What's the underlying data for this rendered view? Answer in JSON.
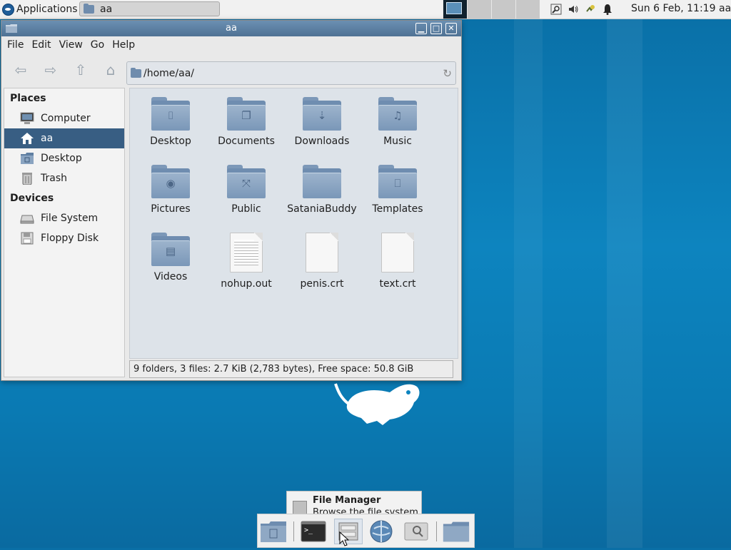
{
  "top_panel": {
    "applications_label": "Applications",
    "task_label": "aa",
    "clock": "Sun  6 Feb, 11:19",
    "user": "aa"
  },
  "window": {
    "title": "aa",
    "menu": [
      "File",
      "Edit",
      "View",
      "Go",
      "Help"
    ],
    "path": "/home/aa/",
    "sidebar": {
      "places_heading": "Places",
      "places": [
        "Computer",
        "aa",
        "Desktop",
        "Trash"
      ],
      "devices_heading": "Devices",
      "devices": [
        "File System",
        "Floppy Disk"
      ]
    },
    "items": [
      {
        "name": "Desktop",
        "icon": "desktop-folder-icon"
      },
      {
        "name": "Documents",
        "icon": "documents-folder-icon"
      },
      {
        "name": "Downloads",
        "icon": "downloads-folder-icon"
      },
      {
        "name": "Music",
        "icon": "music-folder-icon"
      },
      {
        "name": "Pictures",
        "icon": "pictures-folder-icon"
      },
      {
        "name": "Public",
        "icon": "public-folder-icon"
      },
      {
        "name": "SataniaBuddy",
        "icon": "folder-icon"
      },
      {
        "name": "Templates",
        "icon": "templates-folder-icon"
      },
      {
        "name": "Videos",
        "icon": "videos-folder-icon"
      },
      {
        "name": "nohup.out",
        "icon": "text-file-icon"
      },
      {
        "name": "penis.crt",
        "icon": "blank-file-icon"
      },
      {
        "name": "text.crt",
        "icon": "blank-file-icon"
      }
    ],
    "status": "9 folders, 3 files: 2.7 KiB (2,783 bytes), Free space: 50.8 GiB"
  },
  "tooltip": {
    "title": "File Manager",
    "subtitle": "Browse the file system"
  },
  "colors": {
    "desktop": "#0d84bf",
    "titlebar": "#5a7fa3",
    "selection": "#385e83",
    "folder": "#7a97b8"
  }
}
